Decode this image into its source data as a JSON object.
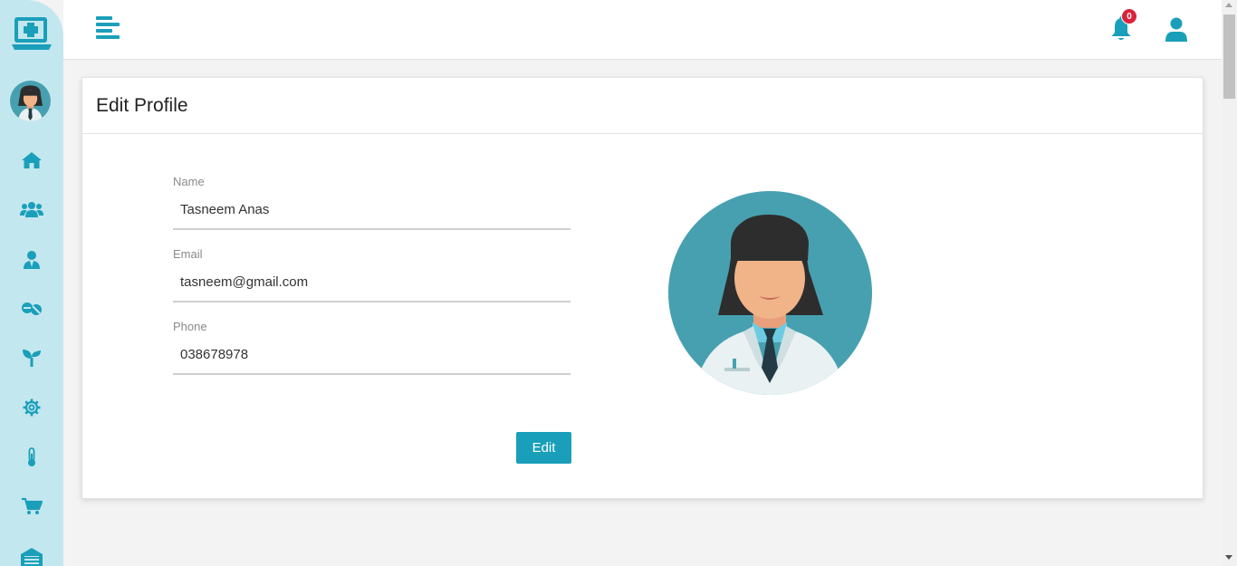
{
  "colors": {
    "primary": "#1a9fba",
    "sidebar_bg": "#c3e7ee",
    "badge": "#d9223a",
    "avatar_bg": "#47a0b0"
  },
  "sidebar": {
    "logo_icon": "laptop-medical-icon",
    "items": [
      {
        "icon": "home-icon"
      },
      {
        "icon": "users-icon"
      },
      {
        "icon": "user-doctor-icon"
      },
      {
        "icon": "pills-icon"
      },
      {
        "icon": "seedling-icon"
      },
      {
        "icon": "gear-icon"
      },
      {
        "icon": "thermometer-icon"
      },
      {
        "icon": "cart-icon"
      },
      {
        "icon": "warehouse-icon"
      }
    ]
  },
  "topbar": {
    "menu_icon": "align-left-icon",
    "notifications_count": "0",
    "user_icon": "user-icon"
  },
  "card": {
    "title": "Edit Profile",
    "fields": {
      "name": {
        "label": "Name",
        "value": "Tasneem Anas"
      },
      "email": {
        "label": "Email",
        "value": "tasneem@gmail.com"
      },
      "phone": {
        "label": "Phone",
        "value": "038678978"
      }
    },
    "edit_button": "Edit"
  }
}
